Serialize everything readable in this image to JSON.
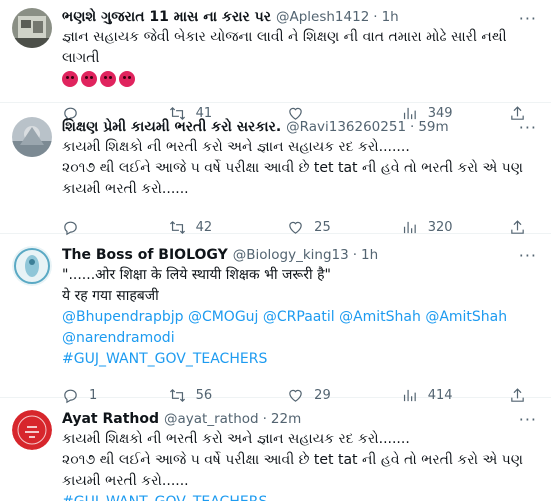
{
  "tweets": [
    {
      "name": "ભણશે ગુજરાત 11 માસ ના કરાર પર",
      "handle": "@Aplesh1412",
      "time": "1h",
      "text": "જ્ઞાન સહાયક જેવી બેકાર યોજના લાવી ને શિક્ષણ ની વાત તમારા મોઢે સારી નથી લાગતી",
      "emojis": [
        "pouting-face",
        "pouting-face",
        "pouting-face",
        "pouting-face"
      ],
      "replies": "",
      "retweets": "41",
      "likes": "",
      "views": "349"
    },
    {
      "name": "શિક્ષણ પ્રેમી કાયમી ભરતી કરો સરકાર.",
      "handle": "@Ravi136260251",
      "time": "59m",
      "text": "કાયમી શિક્ષકો ની ભરતી કરો અને જ્ઞાન સહાયક રદ કરો.......\n૨૦૧૭ થી લઈને આજે ૫ વર્ષે પરીક્ષા આવી છે tet tat ની હવે તો ભરતી કરો એ પણ કાયમી ભરતી કરો......",
      "replies": "",
      "retweets": "42",
      "likes": "25",
      "views": "320"
    },
    {
      "name": "The Boss of BIOLOGY",
      "handle": "@Biology_king13",
      "time": "1h",
      "text": "\"......ओर शिक्षा के लिये स्थायी शिक्षक भी जरूरी है\"\nये रह गया साहबजी",
      "links": [
        "@Bhupendrapbjp @CMOGuj @CRPaatil @AmitShah @AmitShah",
        "@narendramodi",
        "#GUJ_WANT_GOV_TEACHERS"
      ],
      "replies": "1",
      "retweets": "56",
      "likes": "29",
      "views": "414"
    },
    {
      "name": "Ayat Rathod",
      "handle": "@ayat_rathod",
      "time": "22m",
      "text": "કાયમી શિક્ષકો ની ભરતી કરો અને જ્ઞાન સહાયક રદ કરો.......\n૨૦૧૭ થી લઈને આજે ૫ વર્ષે પરીક્ષા આવી છે tet tat ની હવે તો ભરતી કરો એ પણ કાયમી ભરતી કરો......",
      "links": [
        "#GUJ_WANT_GOV_TEACHERS"
      ]
    }
  ],
  "colors": {
    "link": "#1d9bf0",
    "muted": "#536471",
    "text": "#0f1419",
    "border": "#eff3f4"
  }
}
